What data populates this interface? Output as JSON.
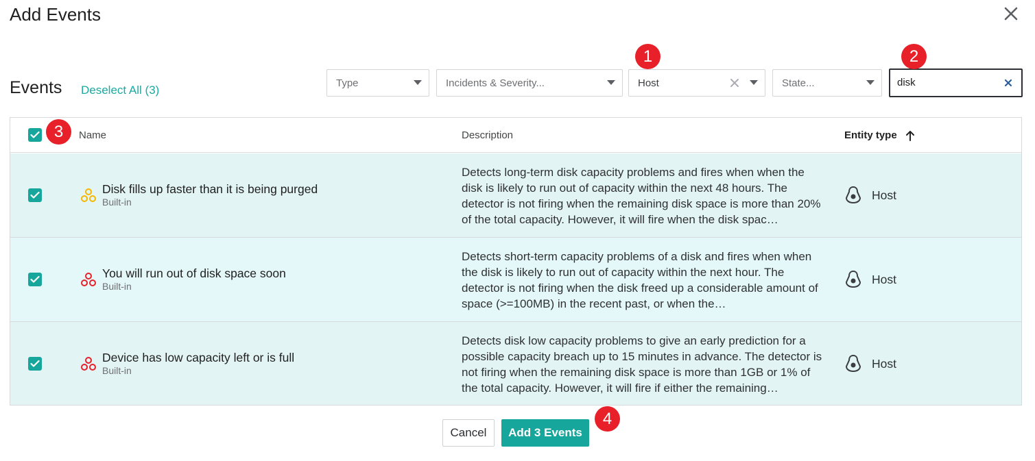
{
  "dialog": {
    "title": "Add Events",
    "close_icon": "close-icon"
  },
  "events_section": {
    "title": "Events",
    "deselect_all": "Deselect All (3)"
  },
  "filters": {
    "type": {
      "placeholder": "Type"
    },
    "incidents": {
      "placeholder": "Incidents & Severity..."
    },
    "entity": {
      "value": "Host"
    },
    "state": {
      "placeholder": "State..."
    },
    "search": {
      "value": "disk"
    }
  },
  "annotations": [
    "1",
    "2",
    "3",
    "4"
  ],
  "table": {
    "columns": {
      "name": "Name",
      "description": "Description",
      "entity_type": "Entity type"
    },
    "sort": {
      "column": "Entity type",
      "direction": "ascending",
      "icon": "arrow-up-icon"
    },
    "select_all_checked": true,
    "rows": [
      {
        "checked": true,
        "name": "Disk fills up faster than it is being purged",
        "source": "Built-in",
        "icon": "event-icon",
        "icon_color": "#f5b800",
        "description": "Detects long-term disk capacity problems and fires when when the disk is likely to run out of capacity within the next 48 hours. The detector is not firing when the remaining disk space is more than 20% of the total capacity. However, it will fire when the disk spac…",
        "entity_type": "Host"
      },
      {
        "checked": true,
        "name": "You will run out of disk space soon",
        "source": "Built-in",
        "icon": "event-icon",
        "icon_color": "#e8202a",
        "description": "Detects short-term capacity problems of a disk and fires when when the disk is likely to run out of capacity within the next hour. The detector is not firing when the disk freed up a considerable amount of space (>=100MB) in the recent past, or when the…",
        "entity_type": "Host"
      },
      {
        "checked": true,
        "name": "Device has low capacity left or is full",
        "source": "Built-in",
        "icon": "event-icon",
        "icon_color": "#e8202a",
        "description": "Detects disk low capacity problems to give an early prediction for a possible capacity breach up to 15 minutes in advance. The detector is not firing when the remaining disk space is more than 1GB or 1% of the total capacity. However, it will fire if either the remaining…",
        "entity_type": "Host"
      }
    ]
  },
  "footer": {
    "cancel": "Cancel",
    "add": "Add 3 Events"
  },
  "colors": {
    "accent": "#16a69c",
    "badge": "#e8202a",
    "row_bg": "#e2f4f3"
  }
}
